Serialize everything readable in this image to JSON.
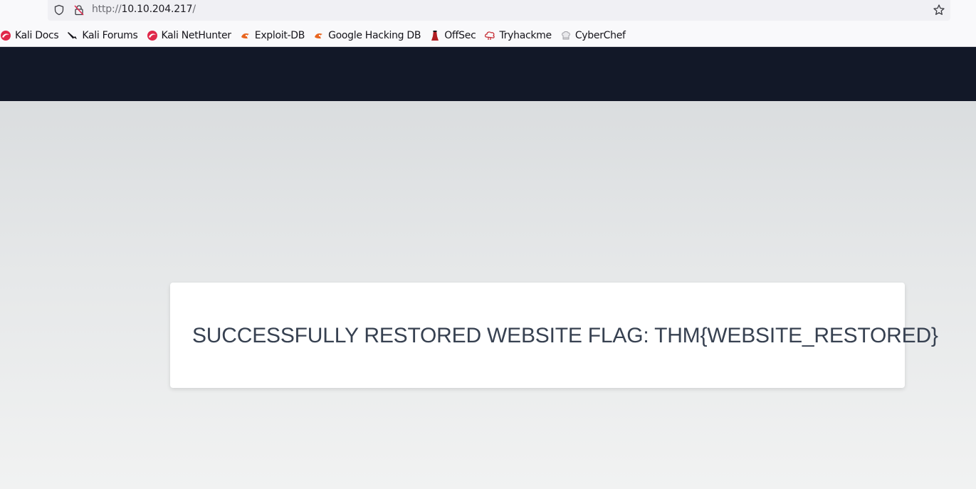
{
  "browser": {
    "url_scheme": "http://",
    "url_host": "10.10.204.217",
    "url_path": "/"
  },
  "bookmarks": [
    {
      "label": "Kali Docs",
      "icon": "kali-dragon-icon"
    },
    {
      "label": "Kali Forums",
      "icon": "kali-knife-icon"
    },
    {
      "label": "Kali NetHunter",
      "icon": "kali-dragon-icon"
    },
    {
      "label": "Exploit-DB",
      "icon": "exploit-db-icon"
    },
    {
      "label": "Google Hacking DB",
      "icon": "ghdb-icon"
    },
    {
      "label": "OffSec",
      "icon": "offsec-icon"
    },
    {
      "label": "Tryhackme",
      "icon": "tryhackme-icon"
    },
    {
      "label": "CyberChef",
      "icon": "cyberchef-icon"
    }
  ],
  "card": {
    "message": "SUCCESSFULLY RESTORED WEBSITE FLAG: THM{WEBSITE_RESTORED}"
  },
  "colors": {
    "header_bg": "#121828",
    "card_text": "#374151",
    "kali_red": "#e0284a",
    "exploit_orange": "#e8651f"
  }
}
